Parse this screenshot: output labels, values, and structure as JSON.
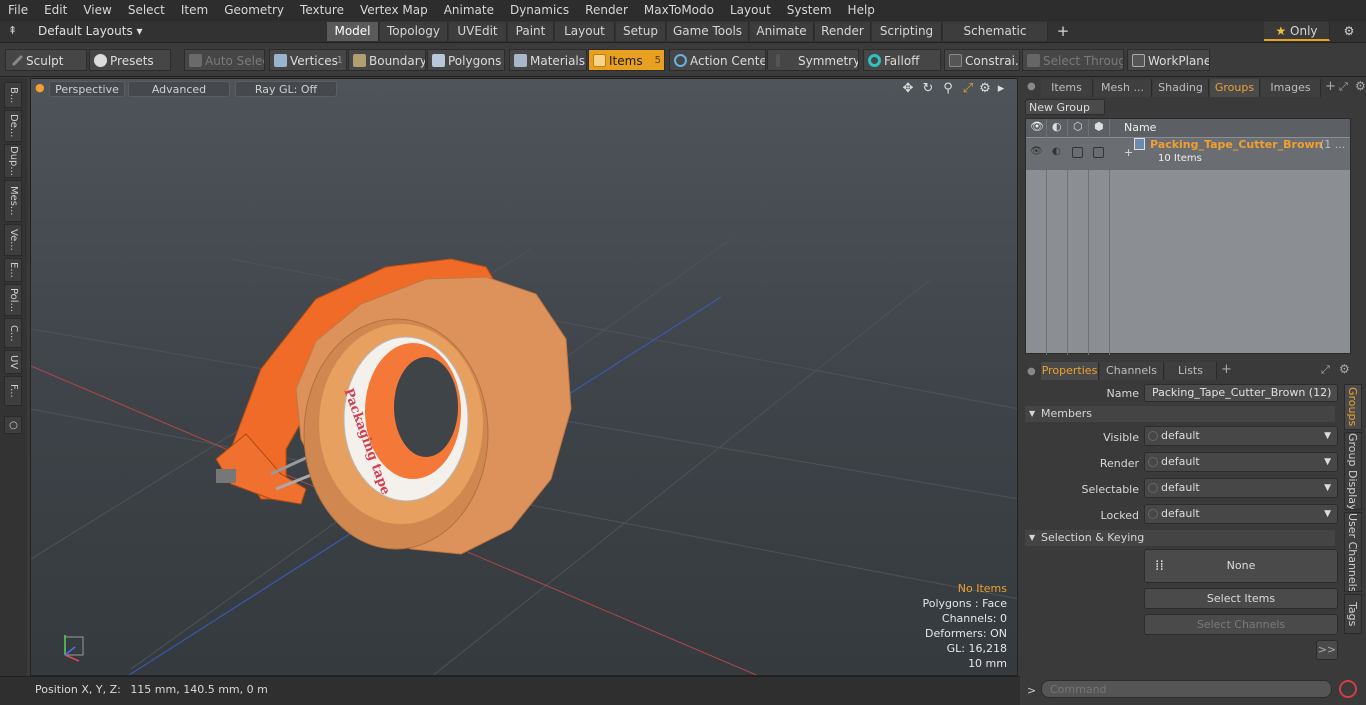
{
  "menu": [
    "File",
    "Edit",
    "View",
    "Select",
    "Item",
    "Geometry",
    "Texture",
    "Vertex Map",
    "Animate",
    "Dynamics",
    "Render",
    "MaxToModo",
    "Layout",
    "System",
    "Help"
  ],
  "layouts": {
    "default_label": "Default Layouts",
    "tabs": [
      "Model",
      "Topology",
      "UVEdit",
      "Paint",
      "Layout",
      "Setup",
      "Game Tools",
      "Animate",
      "Render",
      "Scripting",
      "Schematic Fusion"
    ],
    "active_tab": "Model",
    "only_label": "Only"
  },
  "toolbar": {
    "sculpt": "Sculpt",
    "presets": "Presets",
    "auto_select": "Auto Select",
    "vertices": "Vertices",
    "vertices_count": "1",
    "boundary": "Boundary",
    "polygons": "Polygons",
    "materials": "Materials",
    "items": "Items",
    "items_count": "5",
    "action_center": "Action Center",
    "symmetry": "Symmetry",
    "falloff": "Falloff",
    "constraints": "Constrai...",
    "select_through": "Select Through",
    "workplane": "WorkPlane"
  },
  "left_tabs": [
    "B...",
    "De...",
    "Dup...",
    "Mes...",
    "Ve...",
    "E...",
    "Pol...",
    "C...",
    "UV",
    "F..."
  ],
  "viewport": {
    "perspective": "Perspective",
    "advanced": "Advanced",
    "raygl": "Ray GL: Off",
    "tape_text": "Packaging tape",
    "info": {
      "no_items": "No Items",
      "polygons": "Polygons : Face",
      "channels": "Channels: 0",
      "deformers": "Deformers: ON",
      "gl": "GL: 16,218",
      "size": "10 mm"
    }
  },
  "status": {
    "position_label": "Position X, Y, Z:",
    "position_value": "115 mm, 140.5 mm, 0 m"
  },
  "right_panel": {
    "top_tabs": [
      "Items",
      "Mesh ...",
      "Shading",
      "Groups",
      "Images"
    ],
    "active_top_tab": "Groups",
    "new_group": "New Group",
    "name_col": "Name",
    "group_name": "Packing_Tape_Cutter_Brown",
    "group_suffix": "(1 ...",
    "group_count": "10 Items",
    "prop_tabs": [
      "Properties",
      "Channels",
      "Lists"
    ],
    "name_label": "Name",
    "name_value": "Packing_Tape_Cutter_Brown (12)",
    "members": "Members",
    "visible_label": "Visible",
    "render_label": "Render",
    "selectable_label": "Selectable",
    "locked_label": "Locked",
    "dd_value": "default",
    "sel_keying": "Selection & Keying",
    "none_btn": "None",
    "select_items": "Select Items",
    "select_channels": "Select Channels",
    "more": ">>",
    "side_tabs": [
      "Groups",
      "Group Display",
      "User Channels",
      "Tags"
    ],
    "command_placeholder": "Command"
  }
}
